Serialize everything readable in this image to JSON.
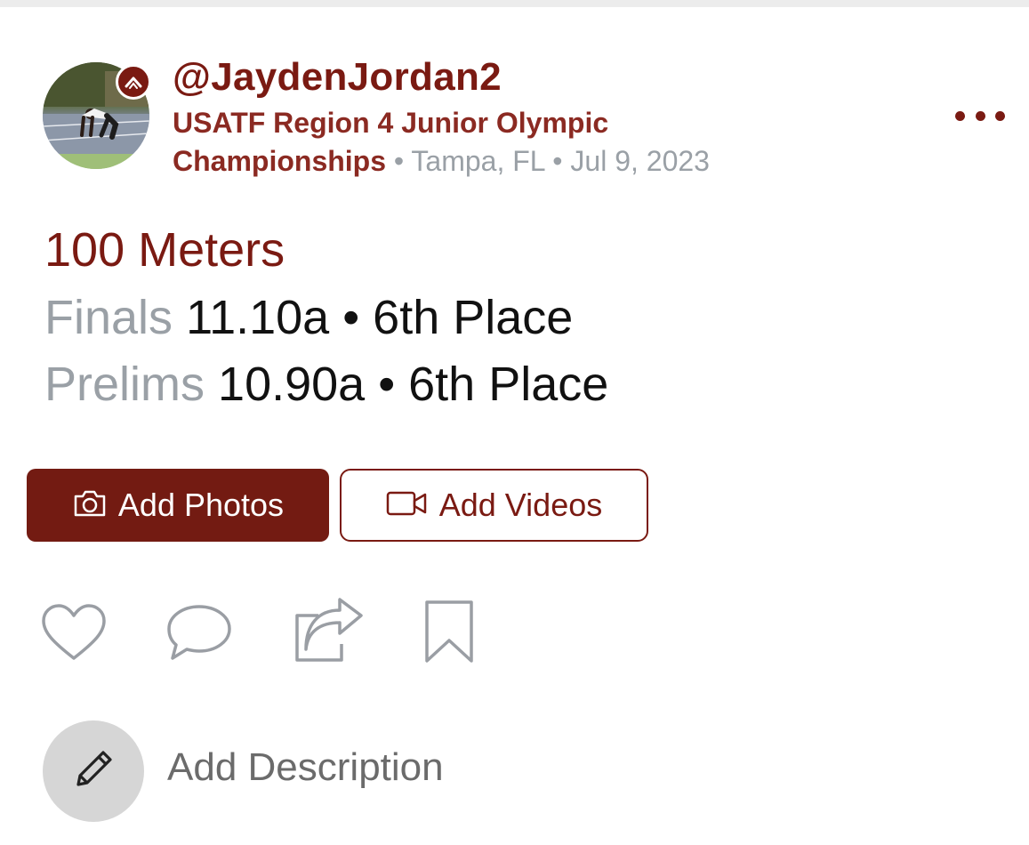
{
  "post": {
    "username": "@JaydenJordan2",
    "meet_name_line1": "USATF Region 4 Junior Olympic",
    "meet_name_line2": "Championships",
    "separator": "•",
    "location": "Tampa, FL",
    "date": "Jul 9, 2023"
  },
  "event": {
    "title": "100 Meters",
    "results": [
      {
        "round": "Finals",
        "time": "11.10a",
        "place": "6th Place"
      },
      {
        "round": "Prelims",
        "time": "10.90a",
        "place": "6th Place"
      }
    ]
  },
  "buttons": {
    "add_photos": "Add Photos",
    "add_videos": "Add Videos"
  },
  "description": {
    "label": "Add Description"
  },
  "icons": {
    "avatar_badge": "chevron-up-icon",
    "more": "more-dots-icon",
    "photos": "camera-icon",
    "videos": "video-camera-icon",
    "like": "heart-icon",
    "comment": "comment-icon",
    "share": "share-icon",
    "save": "bookmark-icon",
    "edit": "pencil-icon"
  },
  "colors": {
    "brand": "#7a1a12",
    "secondary_text": "#9aa0a6",
    "primary_text": "#111111",
    "action_icon": "#9a9ea4",
    "description_circle": "#d6d6d6"
  }
}
